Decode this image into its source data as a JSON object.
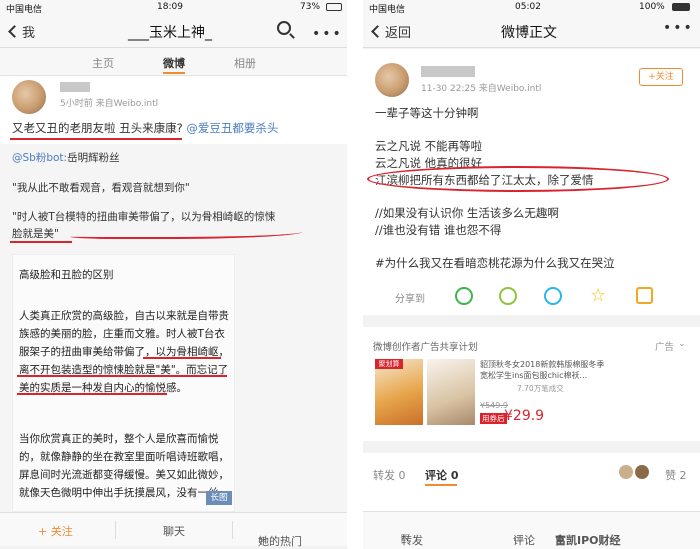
{
  "left": {
    "status": {
      "carrier": "中国电信",
      "time": "18:09",
      "battery": "73%"
    },
    "nav": {
      "back": "我",
      "title": "___玉米上神_"
    },
    "tabs": [
      {
        "label": "主页"
      },
      {
        "label": "微博"
      },
      {
        "label": "相册"
      }
    ],
    "post": {
      "meta": "5小时前 来自Weibo.intl",
      "line1": "又老又丑的老朋友啦 丑头来康康?",
      "line1_mention": "@爱豆丑都要杀头",
      "mention2": "@Sb粉bot:",
      "mention2_rest": "岳明辉粉丝",
      "quote1": "\"我从此不敢看观音，看观音就想到你\"",
      "quote2a": "\"时人被T台模特的扭曲审美带偏了，以为骨相崎岖的惊悚",
      "quote2b": "脸就是美\""
    },
    "image": {
      "heading": "高级脸和丑脸的区别",
      "para1": [
        "人类真正欣赏的高级脸，自古以来就是自带贵",
        "族感的美丽的脸，庄重而文雅。时人被T台衣",
        "服架子的扭曲审美给带偏了，以为骨相崎岖，",
        "离不开包装造型的惊悚脸就是\"美\"。而忘记了",
        "美的实质是一种发自内心的愉悦感。"
      ],
      "para2": [
        "当你欣赏真正的美时，整个人是欣喜而愉悦",
        "的，就像静静的坐在教室里面听唱诗班歌唱，",
        "屏息间时光流逝都变得缓慢。美又如此微妙，",
        "就像天色微明中伸出手抚摸晨风，没有一丝"
      ],
      "badge": "长图"
    },
    "bottom": {
      "follow": "+ 关注",
      "chat": "聊天",
      "hot": "她的热门"
    }
  },
  "right": {
    "status": {
      "carrier": "中国电信",
      "time": "05:02",
      "battery": "100%"
    },
    "nav": {
      "back": "返回",
      "title": "微博正文"
    },
    "post": {
      "meta": "11-30 22:25 来自Weibo.intl",
      "follow": "+关注",
      "lines": [
        "一辈子等这十分钟啊",
        "",
        "云之凡说 不能再等啦",
        "云之凡说 他真的很好",
        "江滨柳把所有东西都给了江太太，除了爱情",
        "",
        "//如果没有认识你 生活该多么无趣啊",
        "//谁也没有错 谁也怨不得",
        "",
        "#为什么我又在看暗恋桃花源为什么我又在哭泣"
      ],
      "share_label": "分享到"
    },
    "ad": {
      "header": "微博创作者广告共享计划",
      "ad_label": "广告",
      "tag": "聚划算",
      "desc1": "貂顶秋冬女2018新款韩版棉服冬季",
      "desc2": "宽松学生ins面包服chic棉袄...",
      "sold": "7.70万笔成交",
      "price_old": "¥549.9",
      "price_label": "用券后",
      "price": "¥29.9"
    },
    "tabs": {
      "repost": "转发 0",
      "comment": "评论 0",
      "like": "赞 2"
    },
    "bottom": {
      "repost": "转发",
      "comment": "评论",
      "watermark": "富凯IPO财经"
    }
  }
}
